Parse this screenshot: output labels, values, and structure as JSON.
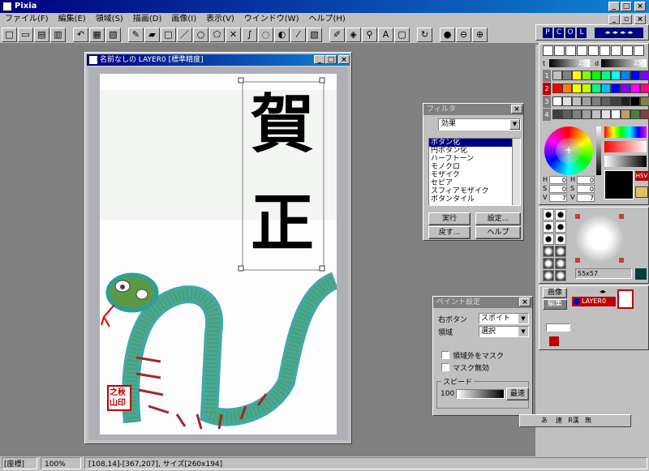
{
  "app": {
    "title": "Pixia"
  },
  "menu": [
    "ファイル(F)",
    "編集(E)",
    "領域(S)",
    "描画(D)",
    "画像(I)",
    "表示(V)",
    "ウインドウ(W)",
    "ヘルプ(H)"
  ],
  "toolbar_icons": [
    "new-icon",
    "open-icon",
    "save-icon",
    "print-icon",
    "undo-icon",
    "redo-icon",
    "copy-icon",
    "pen-icon",
    "eraser-icon",
    "rect-icon",
    "line-icon",
    "ellipse-icon",
    "polygon-icon",
    "cross-icon",
    "curve-icon",
    "lasso-icon",
    "fill-icon",
    "eyedropper-icon",
    "gradient-icon",
    "brush-icon",
    "color-picker-icon",
    "zoom-icon",
    "text-icon",
    "frame-icon",
    "rotate-icon",
    "globe-icon",
    "zoom-out-icon",
    "zoom-in-icon"
  ],
  "canvas_window": {
    "title": "名前なしの LAYER0 [標準精度]"
  },
  "artwork": {
    "char1": "賀",
    "char2": "正",
    "seal": "之秋山印"
  },
  "filter": {
    "title": "フィルタ",
    "category": "効果",
    "items": [
      "ボタン化",
      "円ボタン化",
      "ハーフトーン",
      "モノクロ",
      "モザイク",
      "セピア",
      "スフィアモザイク",
      "ボタンタイル"
    ],
    "selected": "ボタン化",
    "buttons": {
      "run": "実行",
      "settings": "設定...",
      "back": "戻す...",
      "help": "ヘルプ"
    }
  },
  "paint_settings": {
    "title": "ペイント設定",
    "right_button_label": "右ボタン",
    "right_button_value": "スポイト",
    "area_label": "領域",
    "area_value": "選択",
    "mask_outside": "領域外をマスク",
    "mask_off": "マスク無効",
    "speed_label": "スピード",
    "speed_value": "100",
    "speed_mode": "最速"
  },
  "color_panel": {
    "tabs": [
      "P",
      "C",
      "O",
      "L"
    ],
    "slider_t": "255",
    "slider_d": "255",
    "row_nums": [
      "1",
      "2",
      "3",
      "4"
    ],
    "hsv_labels": [
      "H",
      "S",
      "V",
      "H",
      "S",
      "V"
    ],
    "hsv_values": [
      "0",
      "0",
      "7",
      "0",
      "0",
      "7"
    ],
    "hsv_button": "HSV"
  },
  "brush_panel": {
    "size": "55x57"
  },
  "layer_panel": {
    "tab_image": "画像",
    "tab_edit": "編集",
    "layer_name": "LAYER0"
  },
  "ime_bar": [
    "あ",
    "連",
    "R漢",
    "無",
    "",
    ""
  ],
  "status": {
    "mode": "[座標]",
    "zoom": "100%",
    "info": "[108,14]-[367,207], サイズ[260x194]"
  },
  "palette_colors": [
    [
      "#c0c0c0",
      "#808080",
      "#ffff00",
      "#80ff00",
      "#00ff00",
      "#00ff80",
      "#00ffff",
      "#0080ff",
      "#0000ff",
      "#8000ff"
    ],
    [
      "#ff0000",
      "#ff8000",
      "#ffff00",
      "#c0ff00",
      "#00ff80",
      "#00c0ff",
      "#0000ff",
      "#8000ff",
      "#ff00ff",
      "#ff0080"
    ],
    [
      "#ffffff",
      "#e0e0e0",
      "#c0c0c0",
      "#a0a0a0",
      "#808080",
      "#606060",
      "#404040",
      "#202020",
      "#000000",
      "#808040"
    ],
    [
      "#404040",
      "#606060",
      "#808080",
      "#a0a0a0",
      "#c0c0c0",
      "#e0e0e0",
      "#ffffff",
      "#c0a060",
      "#408040",
      "#804040"
    ]
  ]
}
